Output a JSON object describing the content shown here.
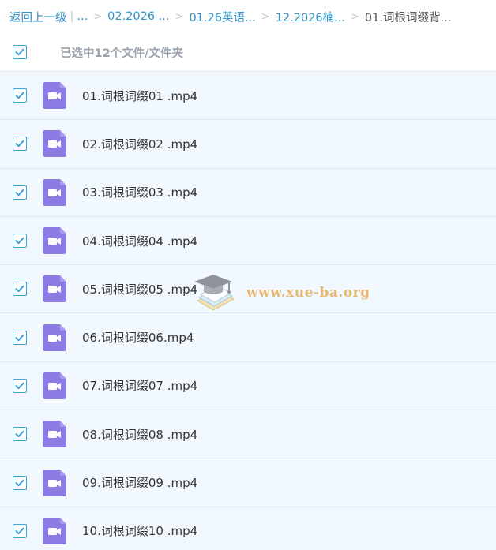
{
  "breadcrumb": {
    "back_label": "返回上一级",
    "ellipsis": "...",
    "items": [
      "02.2026 ...",
      "01.26英语...",
      "12.2026楠..."
    ],
    "current": "01.词根词缀背..."
  },
  "selection": {
    "summary": "已选中12个文件/文件夹",
    "checked": true
  },
  "files": [
    {
      "name": "01.词根词缀01 .mp4",
      "checked": true
    },
    {
      "name": "02.词根词缀02 .mp4",
      "checked": true
    },
    {
      "name": "03.词根词缀03 .mp4",
      "checked": true
    },
    {
      "name": "04.词根词缀04 .mp4",
      "checked": true
    },
    {
      "name": "05.词根词缀05 .mp4",
      "checked": true
    },
    {
      "name": "06.词根词缀06.mp4",
      "checked": true
    },
    {
      "name": "07.词根词缀07 .mp4",
      "checked": true
    },
    {
      "name": "08.词根词缀08 .mp4",
      "checked": true
    },
    {
      "name": "09.词根词缀09 .mp4",
      "checked": true
    },
    {
      "name": "10.词根词缀10 .mp4",
      "checked": true
    }
  ],
  "watermark": {
    "text": "www.xue-ba.org",
    "icon": "graduation-cap-book-icon"
  },
  "colors": {
    "link": "#2f93c7",
    "checkbox": "#3f9fd9",
    "video_icon": "#8b7be3",
    "row_bg": "#f2f9fe",
    "watermark": "#e7b873"
  },
  "icons": {
    "file": "video-file-icon",
    "check": "check-icon"
  }
}
